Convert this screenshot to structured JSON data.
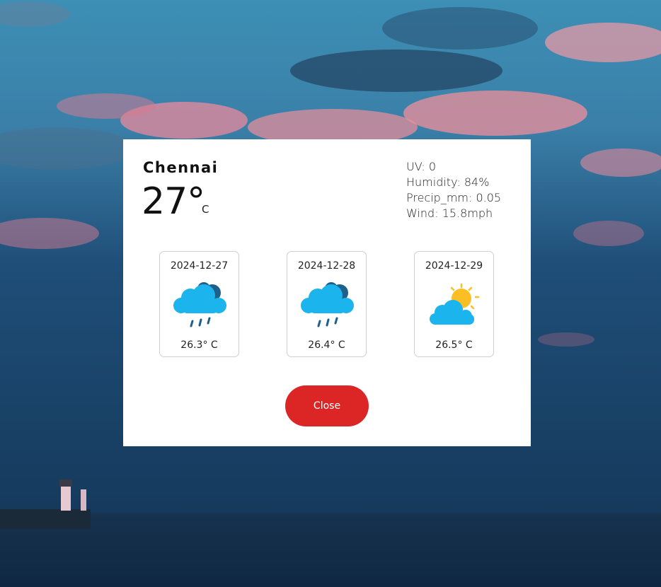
{
  "current": {
    "city": "Chennai",
    "temperature": "27°",
    "unit": "C"
  },
  "stats": [
    "UV: 0",
    "Humidity: 84%",
    "Precip_mm: 0.05",
    "Wind: 15.8mph"
  ],
  "forecast": [
    {
      "date": "2024-12-27",
      "icon": "rain-cloud-icon",
      "temp": "26.3° C"
    },
    {
      "date": "2024-12-28",
      "icon": "rain-cloud-icon",
      "temp": "26.4° C"
    },
    {
      "date": "2024-12-29",
      "icon": "partly-sunny-icon",
      "temp": "26.5° C"
    }
  ],
  "actions": {
    "close_label": "Close"
  },
  "colors": {
    "cloud_light": "#1cb4ec",
    "cloud_dark": "#1f5f8b",
    "sun": "#fbbf24",
    "close_button": "#dc2626"
  }
}
